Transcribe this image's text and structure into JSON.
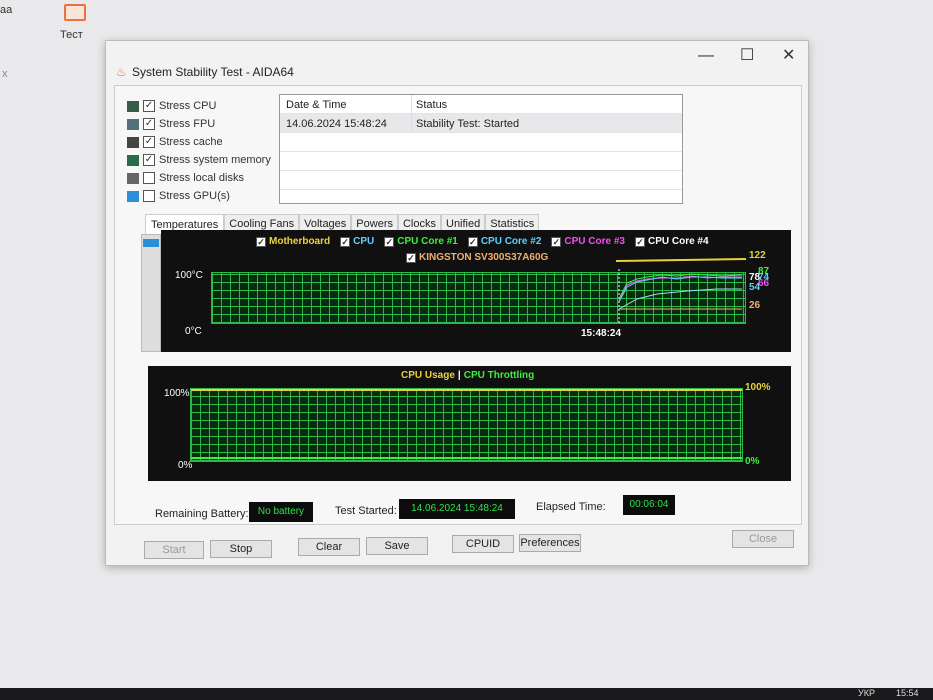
{
  "desktop": {
    "icon_label": "Тест",
    "left_fragment": "аа",
    "left_x": "x",
    "tray_lang": "УКР",
    "tray_time": "15:54"
  },
  "window": {
    "title": "System Stability Test - AIDA64",
    "minimize": "—",
    "maximize": "☐",
    "close": "✕"
  },
  "options": [
    {
      "label": "Stress CPU",
      "checked": true,
      "icon": "cpu-icon"
    },
    {
      "label": "Stress FPU",
      "checked": true,
      "icon": "fpu-icon"
    },
    {
      "label": "Stress cache",
      "checked": true,
      "icon": "cache-icon"
    },
    {
      "label": "Stress system memory",
      "checked": true,
      "icon": "memory-icon"
    },
    {
      "label": "Stress local disks",
      "checked": false,
      "icon": "disk-icon"
    },
    {
      "label": "Stress GPU(s)",
      "checked": false,
      "icon": "gpu-icon"
    }
  ],
  "log": {
    "headers": [
      "Date & Time",
      "Status"
    ],
    "rows": [
      [
        "14.06.2024 15:48:24",
        "Stability Test: Started"
      ]
    ]
  },
  "tabs": [
    "Temperatures",
    "Cooling Fans",
    "Voltages",
    "Powers",
    "Clocks",
    "Unified",
    "Statistics"
  ],
  "temp_chart": {
    "legend": [
      {
        "label": "Motherboard",
        "color": "#f0d23c"
      },
      {
        "label": "CPU",
        "color": "#5fd0ff"
      },
      {
        "label": "CPU Core #1",
        "color": "#3cf03c"
      },
      {
        "label": "CPU Core #2",
        "color": "#5fd0ff"
      },
      {
        "label": "CPU Core #3",
        "color": "#f050f0"
      },
      {
        "label": "CPU Core #4",
        "color": "#ffffff"
      },
      {
        "label": "KINGSTON SV300S37A60G",
        "color": "#f0b070"
      }
    ],
    "y_max": "100°C",
    "y_min": "0°C",
    "time": "15:48:24",
    "values": [
      {
        "v": "122",
        "color": "#e6d23c"
      },
      {
        "v": "87",
        "color": "#3cf03c"
      },
      {
        "v": "78",
        "color": "#ffffff"
      },
      {
        "v": "74",
        "color": "#5fd0ff"
      },
      {
        "v": "66",
        "color": "#f050f0"
      },
      {
        "v": "54",
        "color": "#5fd0ff"
      },
      {
        "v": "26",
        "color": "#f0b070"
      }
    ]
  },
  "usage_chart": {
    "title1": "CPU Usage",
    "sep": "|",
    "title2": "CPU Throttling",
    "y_max": "100%",
    "y_min": "0%",
    "right_max": "100%",
    "right_min": "0%",
    "usage_pct": 100,
    "throttle_pct": 0
  },
  "status": {
    "battery_label": "Remaining Battery:",
    "battery": "No battery",
    "started_label": "Test Started:",
    "started": "14.06.2024 15:48:24",
    "elapsed_label": "Elapsed Time:",
    "elapsed": "00:06:04"
  },
  "buttons": {
    "start": "Start",
    "stop": "Stop",
    "clear": "Clear",
    "save": "Save",
    "cpuid": "CPUID",
    "preferences": "Preferences",
    "close": "Close"
  }
}
